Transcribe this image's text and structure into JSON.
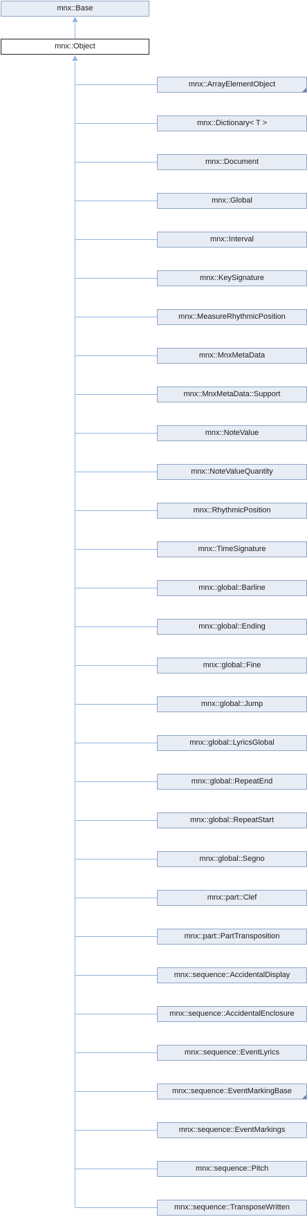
{
  "base": {
    "label": "mnx::Base"
  },
  "object": {
    "label": "mnx::Object"
  },
  "children": [
    {
      "label": "mnx::ArrayElementObject",
      "has_children": true
    },
    {
      "label": "mnx::Dictionary< T >",
      "has_children": false
    },
    {
      "label": "mnx::Document",
      "has_children": false
    },
    {
      "label": "mnx::Global",
      "has_children": false
    },
    {
      "label": "mnx::Interval",
      "has_children": false
    },
    {
      "label": "mnx::KeySignature",
      "has_children": false
    },
    {
      "label": "mnx::MeasureRhythmicPosition",
      "has_children": false
    },
    {
      "label": "mnx::MnxMetaData",
      "has_children": false
    },
    {
      "label": "mnx::MnxMetaData::Support",
      "has_children": false
    },
    {
      "label": "mnx::NoteValue",
      "has_children": false
    },
    {
      "label": "mnx::NoteValueQuantity",
      "has_children": false
    },
    {
      "label": "mnx::RhythmicPosition",
      "has_children": false
    },
    {
      "label": "mnx::TimeSignature",
      "has_children": false
    },
    {
      "label": "mnx::global::Barline",
      "has_children": false
    },
    {
      "label": "mnx::global::Ending",
      "has_children": false
    },
    {
      "label": "mnx::global::Fine",
      "has_children": false
    },
    {
      "label": "mnx::global::Jump",
      "has_children": false
    },
    {
      "label": "mnx::global::LyricsGlobal",
      "has_children": false
    },
    {
      "label": "mnx::global::RepeatEnd",
      "has_children": false
    },
    {
      "label": "mnx::global::RepeatStart",
      "has_children": false
    },
    {
      "label": "mnx::global::Segno",
      "has_children": false
    },
    {
      "label": "mnx::part::Clef",
      "has_children": false
    },
    {
      "label": "mnx::part::PartTransposition",
      "has_children": false
    },
    {
      "label": "mnx::sequence::AccidentalDisplay",
      "has_children": false
    },
    {
      "label": "mnx::sequence::AccidentalEnclosure",
      "has_children": false
    },
    {
      "label": "mnx::sequence::EventLyrics",
      "has_children": false
    },
    {
      "label": "mnx::sequence::EventMarkingBase",
      "has_children": true
    },
    {
      "label": "mnx::sequence::EventMarkings",
      "has_children": false
    },
    {
      "label": "mnx::sequence::Pitch",
      "has_children": false
    },
    {
      "label": "mnx::sequence::TransposeWritten",
      "has_children": false
    }
  ],
  "colors": {
    "connector": "#8fb4e0",
    "node_fill": "#e8edf5",
    "node_border": "#8ea3c4",
    "current_border": "#222222"
  }
}
